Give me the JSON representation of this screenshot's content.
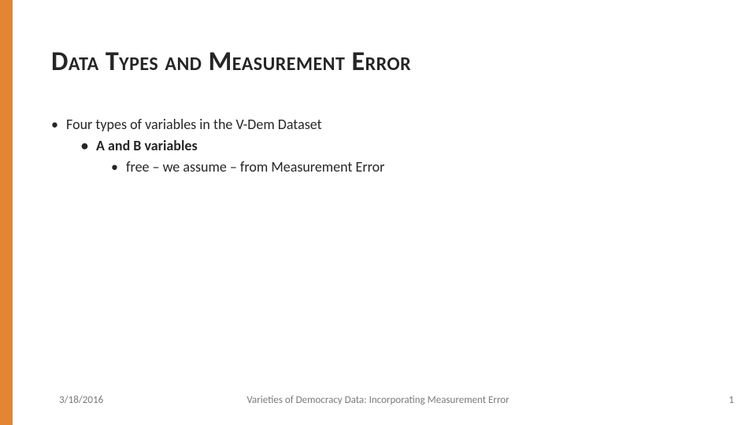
{
  "slide": {
    "title": "Data Types and Measurement Error",
    "bullets": {
      "lvl1": "Four types of variables in the V-Dem Dataset",
      "lvl2": "A and B variables",
      "lvl3": "free – we assume – from Measurement Error"
    },
    "footer": {
      "date": "3/18/2016",
      "title": "Varieties of Democracy Data: Incorporating Measurement Error",
      "page": "1"
    }
  }
}
